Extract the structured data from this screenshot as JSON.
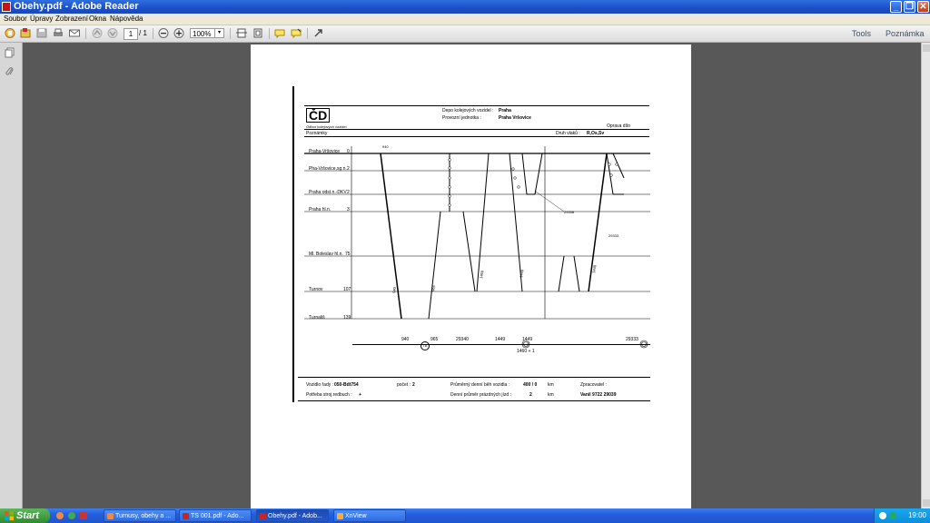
{
  "window": {
    "title": "Obehy.pdf - Adobe Reader",
    "min": "_",
    "max": "❐",
    "close": "✕"
  },
  "menu": [
    "Soubor",
    "Úpravy",
    "Zobrazení",
    "Okna",
    "Nápověda"
  ],
  "toolbar": {
    "page_current": "1",
    "page_total": "/ 1",
    "zoom": "100%",
    "zoom_arrow": "▾",
    "tools": "Tools",
    "comment": "Poznámka"
  },
  "document": {
    "logo": "ČD",
    "logo_caption": "Odbor kolejových vozidel",
    "depo_label": "Depo kolejových vozidel :",
    "depo_value": "Praha",
    "provozni_label": "Provozní jednotka :",
    "provozni_value": "Praha Vršovice",
    "poznamky": "Poznámky",
    "druh_label": "Druh vlaků :",
    "druh_value": "R,Os,Sv",
    "oprava": "Oprava dílo",
    "stations": [
      {
        "name": "Praha-Vršovice",
        "km": "0"
      },
      {
        "name": "Pha-Vršovice,sg.n.",
        "km": "2"
      },
      {
        "name": "Praha odst.n.-DKV",
        "km": "2"
      },
      {
        "name": "Praha hl.n.",
        "km": "3"
      },
      {
        "name": "Ml. Boleslav hl.n.",
        "km": "75"
      },
      {
        "name": "Turnov",
        "km": "107"
      },
      {
        "name": "Turnališ",
        "km": "139"
      }
    ],
    "bottom_axis": [
      "940",
      "TA",
      "965",
      "29340",
      "1449",
      "1449",
      "29333"
    ],
    "axis_note": "1460 + 1",
    "footer": {
      "vozidlo_label": "Vozidlo řady :",
      "vozidlo_value": "050-Bdt754",
      "pocet_label": "počet :",
      "pocet_value": "2",
      "prumerny_label": "Průměrný denní běh vozidla :",
      "prumerny_value": "400 / 0",
      "km1": "km",
      "zpracovatel_label": "Zpracovatel :",
      "potreba_label": "Potřeba stroj.redbuch :",
      "potreba_value": "+",
      "denni_label": "Denní průměr prázdných jízd :",
      "denni_value": "2",
      "km2": "km",
      "vanil": "Vanil   9722 29039"
    }
  },
  "taskbar": {
    "start": "Start",
    "tasks": [
      "Turnusy, obehy a ...",
      "TS 001.pdf - Ado...",
      "Obehy.pdf - Adob...",
      "XnView"
    ],
    "clock": "19:00"
  }
}
